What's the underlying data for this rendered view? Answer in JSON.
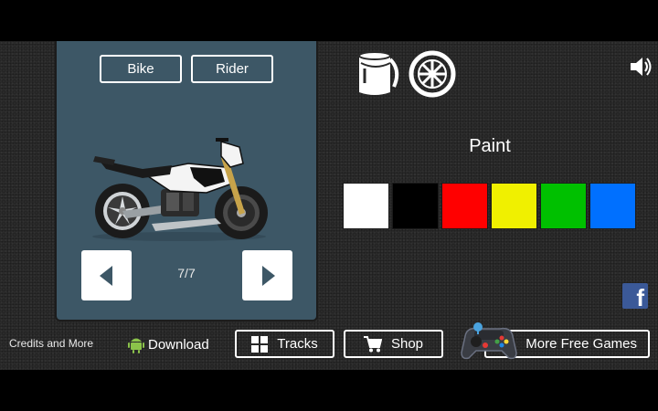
{
  "garage": {
    "tabs": [
      {
        "label": "Bike"
      },
      {
        "label": "Rider"
      }
    ],
    "counter": "7/7"
  },
  "customize": {
    "section_title": "Paint",
    "colors": [
      "#ffffff",
      "#000000",
      "#ff0000",
      "#f0f000",
      "#00c000",
      "#0070ff"
    ]
  },
  "footer": {
    "credits": "Credits and More",
    "download": "Download",
    "tracks": "Tracks",
    "shop": "Shop",
    "more_games": "More Free Games"
  },
  "icons": {
    "paint": "paint-bucket-icon",
    "wheel": "wheel-icon",
    "sound": "speaker-icon",
    "facebook": "facebook-icon",
    "android": "android-icon",
    "grid": "grid-icon",
    "cart": "cart-icon",
    "gamepad": "gamepad-icon"
  }
}
